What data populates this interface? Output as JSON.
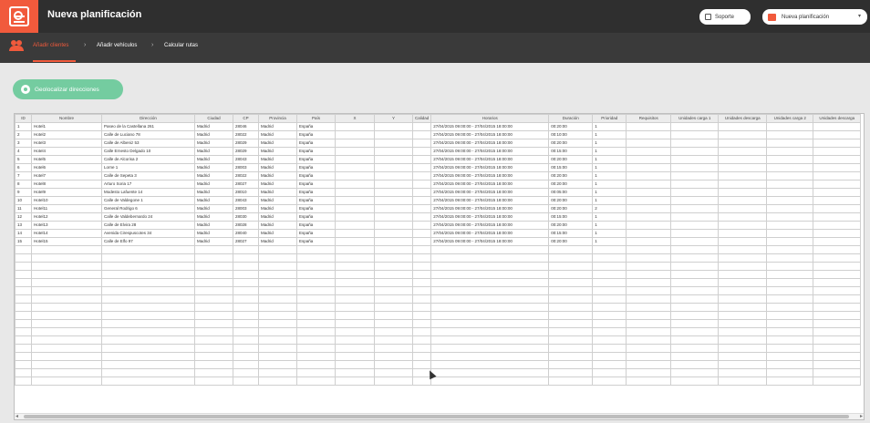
{
  "header": {
    "title": "Nueva planificación",
    "support_label": "Soporte",
    "plan_label": "Nueva planificación"
  },
  "steps": [
    {
      "label": "Añadir clientes",
      "active": true
    },
    {
      "label": "Añadir vehículos",
      "active": false
    },
    {
      "label": "Calcular rutas",
      "active": false
    }
  ],
  "geolocate_label": "Geolocalizar direcciones",
  "table": {
    "columns": [
      "ID",
      "Nombre",
      "Dirección",
      "Ciudad",
      "CP",
      "Provincia",
      "País",
      "X",
      "Y",
      "Calidad",
      "Horarios",
      "Duración",
      "Prioridad",
      "Requisitos",
      "Unidades carga 1",
      "Unidades descarga",
      "Unidades carga 2",
      "Unidades descarga"
    ],
    "rows": [
      [
        "1",
        "Hotel1",
        "Paseo de la Castellana 261",
        "Madrid",
        "28046",
        "Madrid",
        "España",
        "",
        "",
        "",
        "27/04/2015 09:00:00 - 27/04/2015 18:00:00",
        "00:20:00",
        "1",
        "",
        "",
        "",
        "",
        ""
      ],
      [
        "2",
        "Hotel2",
        "Calle de Luciano 78",
        "Madrid",
        "28022",
        "Madrid",
        "España",
        "",
        "",
        "",
        "27/04/2015 09:00:00 - 27/04/2015 18:00:00",
        "00:10:00",
        "1",
        "",
        "",
        "",
        "",
        ""
      ],
      [
        "3",
        "Hotel3",
        "Calle de Albeniz 53",
        "Madrid",
        "28029",
        "Madrid",
        "España",
        "",
        "",
        "",
        "27/04/2015 09:00:00 - 27/04/2015 18:00:00",
        "00:20:00",
        "1",
        "",
        "",
        "",
        "",
        ""
      ],
      [
        "4",
        "Hotel4",
        "Calle Ernesto Delgado 10",
        "Madrid",
        "28029",
        "Madrid",
        "España",
        "",
        "",
        "",
        "27/04/2015 09:00:00 - 27/04/2015 18:00:00",
        "00:15:00",
        "1",
        "",
        "",
        "",
        "",
        ""
      ],
      [
        "5",
        "Hotel5",
        "Calle de Alcorisa 2",
        "Madrid",
        "28043",
        "Madrid",
        "España",
        "",
        "",
        "",
        "27/04/2015 09:00:00 - 27/04/2015 18:00:00",
        "00:20:00",
        "1",
        "",
        "",
        "",
        "",
        ""
      ],
      [
        "6",
        "Hotel6",
        "Lorne 1",
        "Madrid",
        "28003",
        "Madrid",
        "España",
        "",
        "",
        "",
        "27/04/2015 09:00:00 - 27/04/2015 18:00:00",
        "00:15:00",
        "1",
        "",
        "",
        "",
        "",
        ""
      ],
      [
        "7",
        "Hotel7",
        "Calle de Sepeta 3",
        "Madrid",
        "28022",
        "Madrid",
        "España",
        "",
        "",
        "",
        "27/04/2015 09:00:00 - 27/04/2015 18:00:00",
        "00:20:00",
        "1",
        "",
        "",
        "",
        "",
        ""
      ],
      [
        "8",
        "Hotel8",
        "Arturo Soria 17",
        "Madrid",
        "28027",
        "Madrid",
        "España",
        "",
        "",
        "",
        "27/04/2015 09:00:00 - 27/04/2015 18:00:00",
        "00:20:00",
        "1",
        "",
        "",
        "",
        "",
        ""
      ],
      [
        "9",
        "Hotel9",
        "Modesto Lafuente 14",
        "Madrid",
        "28010",
        "Madrid",
        "España",
        "",
        "",
        "",
        "27/04/2015 09:00:00 - 27/04/2015 18:00:00",
        "00:05:00",
        "1",
        "",
        "",
        "",
        "",
        ""
      ],
      [
        "10",
        "Hotel10",
        "Calle de Valdegone 1",
        "Madrid",
        "28043",
        "Madrid",
        "España",
        "",
        "",
        "",
        "27/04/2015 09:00:00 - 27/04/2015 18:00:00",
        "00:20:00",
        "1",
        "",
        "",
        "",
        "",
        ""
      ],
      [
        "11",
        "Hotel11",
        "General Rodrigo 6",
        "Madrid",
        "28003",
        "Madrid",
        "España",
        "",
        "",
        "",
        "27/04/2015 09:00:00 - 27/04/2015 18:00:00",
        "00:20:00",
        "2",
        "",
        "",
        "",
        "",
        ""
      ],
      [
        "12",
        "Hotel12",
        "Calle de Valdebernardo 24",
        "Madrid",
        "28030",
        "Madrid",
        "España",
        "",
        "",
        "",
        "27/04/2015 09:00:00 - 27/04/2015 18:00:00",
        "00:15:00",
        "1",
        "",
        "",
        "",
        "",
        ""
      ],
      [
        "13",
        "Hotel13",
        "Calle de Elvira 28",
        "Madrid",
        "28028",
        "Madrid",
        "España",
        "",
        "",
        "",
        "27/04/2015 09:00:00 - 27/04/2015 18:00:00",
        "00:20:00",
        "1",
        "",
        "",
        "",
        "",
        ""
      ],
      [
        "14",
        "Hotel14",
        "Avenida Cirespuscotes 34",
        "Madrid",
        "28040",
        "Madrid",
        "España",
        "",
        "",
        "",
        "27/04/2015 09:00:00 - 27/04/2015 18:00:00",
        "00:15:00",
        "1",
        "",
        "",
        "",
        "",
        ""
      ],
      [
        "15",
        "Hotel15",
        "Calle de Elfo 97",
        "Madrid",
        "28027",
        "Madrid",
        "España",
        "",
        "",
        "",
        "27/04/2015 09:00:00 - 27/04/2015 18:00:00",
        "00:20:00",
        "1",
        "",
        "",
        "",
        "",
        ""
      ]
    ]
  },
  "colors": {
    "accent": "#f15a3c",
    "geo_button": "#74cca0",
    "topbar": "#2f2f2f"
  }
}
